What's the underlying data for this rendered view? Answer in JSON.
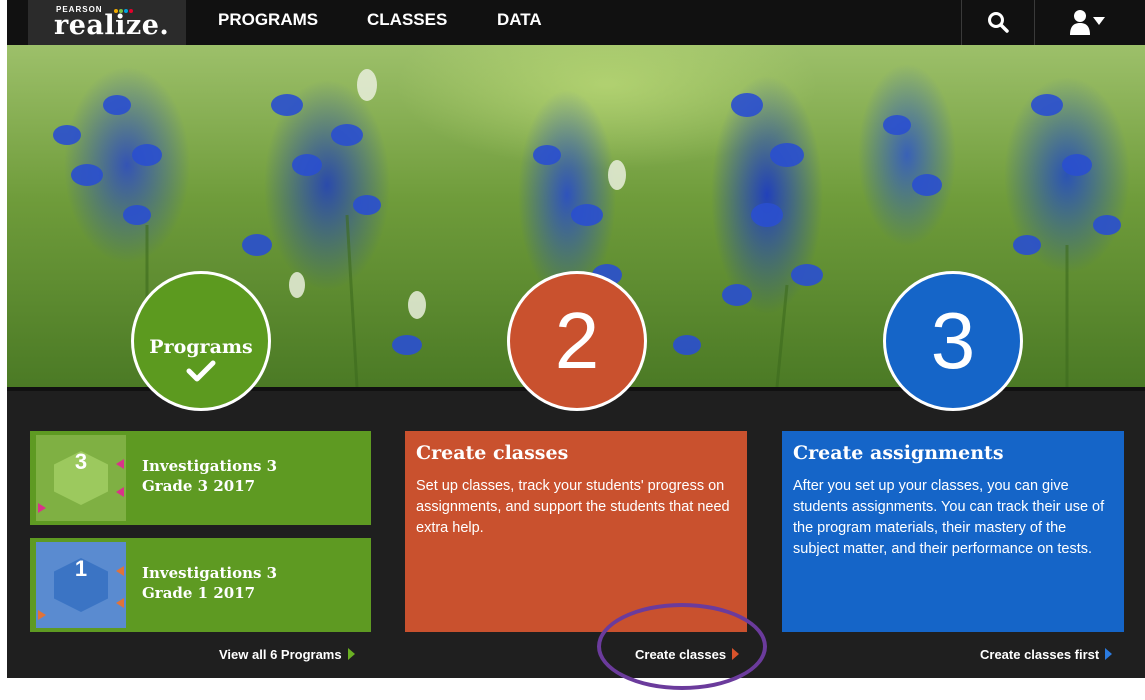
{
  "brand": {
    "small": "PEARSON",
    "name": "realize."
  },
  "nav": {
    "programs": "PROGRAMS",
    "classes": "CLASSES",
    "data": "DATA"
  },
  "icons": {
    "search": "search-icon",
    "user": "user-icon",
    "dropdown": "caret-down-icon",
    "check": "checkmark-icon"
  },
  "steps": {
    "step1": {
      "label": "Programs"
    },
    "step2": {
      "number": "2"
    },
    "step3": {
      "number": "3"
    }
  },
  "programs": [
    {
      "grade_badge": "3",
      "title_line1": "Investigations 3",
      "title_line2": "Grade 3 2017"
    },
    {
      "grade_badge": "1",
      "title_line1": "Investigations 3",
      "title_line2": "Grade 1 2017"
    }
  ],
  "view_all": "View all 6 Programs",
  "create_classes": {
    "title": "Create classes",
    "body": "Set up classes, track your students' progress on assignments, and support the students that need extra help.",
    "link": "Create classes"
  },
  "create_assignments": {
    "title": "Create assignments",
    "body": "After you set up your classes, you can give students assignments. You can track their use of the program materials, their mastery of the subject matter, and their performance on tests.",
    "link": "Create classes first"
  },
  "colors": {
    "green": "#5e9a22",
    "orange": "#c9512e",
    "blue": "#1565c8",
    "annotation": "#6b3b9c"
  }
}
